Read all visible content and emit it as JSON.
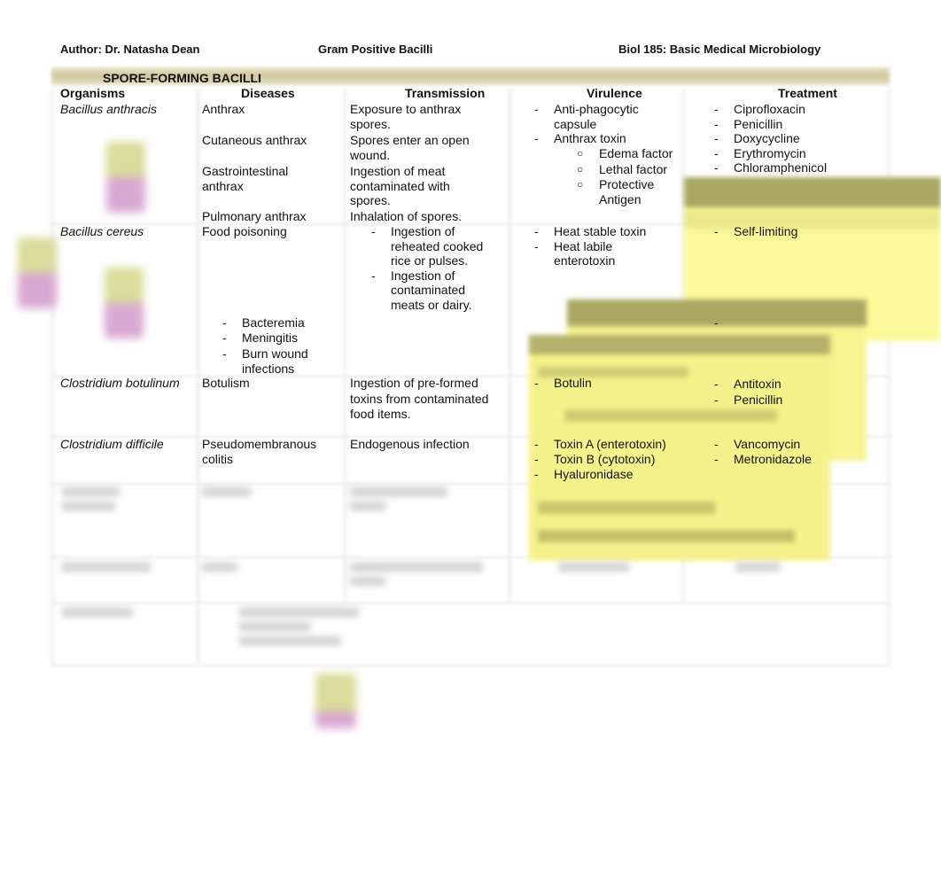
{
  "header": {
    "author": "Author: Dr. Natasha Dean",
    "topic": "Gram Positive Bacilli",
    "course": "Biol 185: Basic Medical Microbiology"
  },
  "section_title": "SPORE-FORMING BACILLI",
  "columns": [
    "Organisms",
    "Diseases",
    "Transmission",
    "Virulence",
    "Treatment"
  ],
  "rows": [
    {
      "organism": "Bacillus anthracis",
      "diseases": [
        "Anthrax",
        "Cutaneous anthrax",
        "Gastrointestinal anthrax",
        "Pulmonary anthrax"
      ],
      "transmission": [
        "Exposure to anthrax spores.",
        "Spores enter an open wound.",
        "Ingestion of meat contaminated with spores.",
        "Inhalation of spores."
      ],
      "virulence": [
        "Anti-phagocytic capsule",
        "Anthrax toxin"
      ],
      "virulence_sub": [
        "Edema factor",
        "Lethal factor",
        "Protective Antigen"
      ],
      "treatment": [
        "Ciprofloxacin",
        "Penicillin",
        "Doxycycline",
        "Erythromycin",
        "Chloramphenicol"
      ]
    },
    {
      "organism": "Bacillus cereus",
      "diseases": [
        "Food poisoning"
      ],
      "diseases_sub": [
        "Bacteremia",
        "Meningitis",
        "Burn wound infections"
      ],
      "transmission": [
        "Ingestion of reheated cooked rice or pulses.",
        "Ingestion of contaminated meats or dairy."
      ],
      "virulence": [
        "Heat stable toxin",
        "Heat labile enterotoxin"
      ],
      "treatment": [
        "Self-limiting"
      ],
      "treatment_extra": "-"
    },
    {
      "organism": "Clostridium botulinum",
      "diseases": [
        "Botulism"
      ],
      "transmission": [
        "Ingestion of pre-formed toxins from contaminated food items."
      ],
      "virulence": [
        "Botulin"
      ],
      "treatment": [
        "Antitoxin",
        "Penicillin"
      ]
    },
    {
      "organism": "Clostridium difficile",
      "diseases": [
        "Pseudomembranous colitis"
      ],
      "transmission": [
        "Endogenous infection"
      ],
      "virulence": [
        "Toxin A (enterotoxin)",
        "Toxin B (cytotoxin)",
        "Hyaluronidase"
      ],
      "treatment": [
        "Vancomycin",
        "Metronidazole"
      ]
    }
  ],
  "colors": {
    "banner": "#cfc59c",
    "sticky_note": "#fbfa9a",
    "sticky_note_header": "#a9a761",
    "flask_top": "#d9dc9a",
    "flask_bottom": "#d9a8d3"
  }
}
